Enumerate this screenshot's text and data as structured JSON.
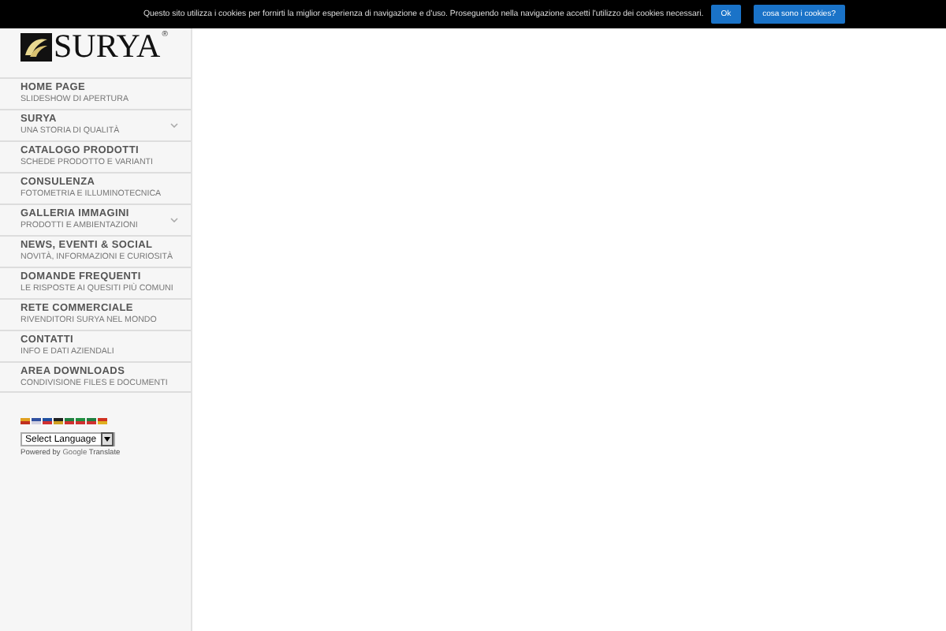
{
  "cookie_bar": {
    "message": "Questo sito utilizza i cookies per fornirti la miglior esperienza di navigazione e d'uso. Proseguendo nella navigazione accetti l'utilizzo dei cookies necessari.",
    "buttons": [
      "Ok",
      "cosa sono i cookies?"
    ]
  },
  "logo": {
    "text": "SURYA",
    "registered": "®"
  },
  "menu": [
    {
      "title": "HOME PAGE",
      "subtitle": "SLIDESHOW DI APERTURA",
      "has_submenu": false
    },
    {
      "title": "SURYA",
      "subtitle": "UNA STORIA DI QUALITÀ",
      "has_submenu": true
    },
    {
      "title": "CATALOGO PRODOTTI",
      "subtitle": "SCHEDE PRODOTTO E VARIANTI",
      "has_submenu": false
    },
    {
      "title": "CONSULENZA",
      "subtitle": "FOTOMETRIA E ILLUMINOTECNICA",
      "has_submenu": false
    },
    {
      "title": "GALLERIA IMMAGINI",
      "subtitle": "PRODOTTI E AMBIENTAZIONI",
      "has_submenu": true
    },
    {
      "title": "NEWS, EVENTI & SOCIAL",
      "subtitle": "NOVITÀ, INFORMAZIONI E CURIOSITÀ",
      "has_submenu": false
    },
    {
      "title": "DOMANDE FREQUENTI",
      "subtitle": "LE RISPOSTE AI QUESITI PIÙ COMUNI",
      "has_submenu": false
    },
    {
      "title": "RETE COMMERCIALE",
      "subtitle": "RIVENDITORI SURYA NEL MONDO",
      "has_submenu": false
    },
    {
      "title": "CONTATTI",
      "subtitle": "INFO E DATI AZIENDALI",
      "has_submenu": false
    },
    {
      "title": "AREA DOWNLOADS",
      "subtitle": "CONDIVISIONE FILES E DOCUMENTI",
      "has_submenu": false
    }
  ],
  "translate": {
    "select": "Select Language",
    "powered_by": "Powered by",
    "brand": "Google",
    "product": "Translate"
  }
}
